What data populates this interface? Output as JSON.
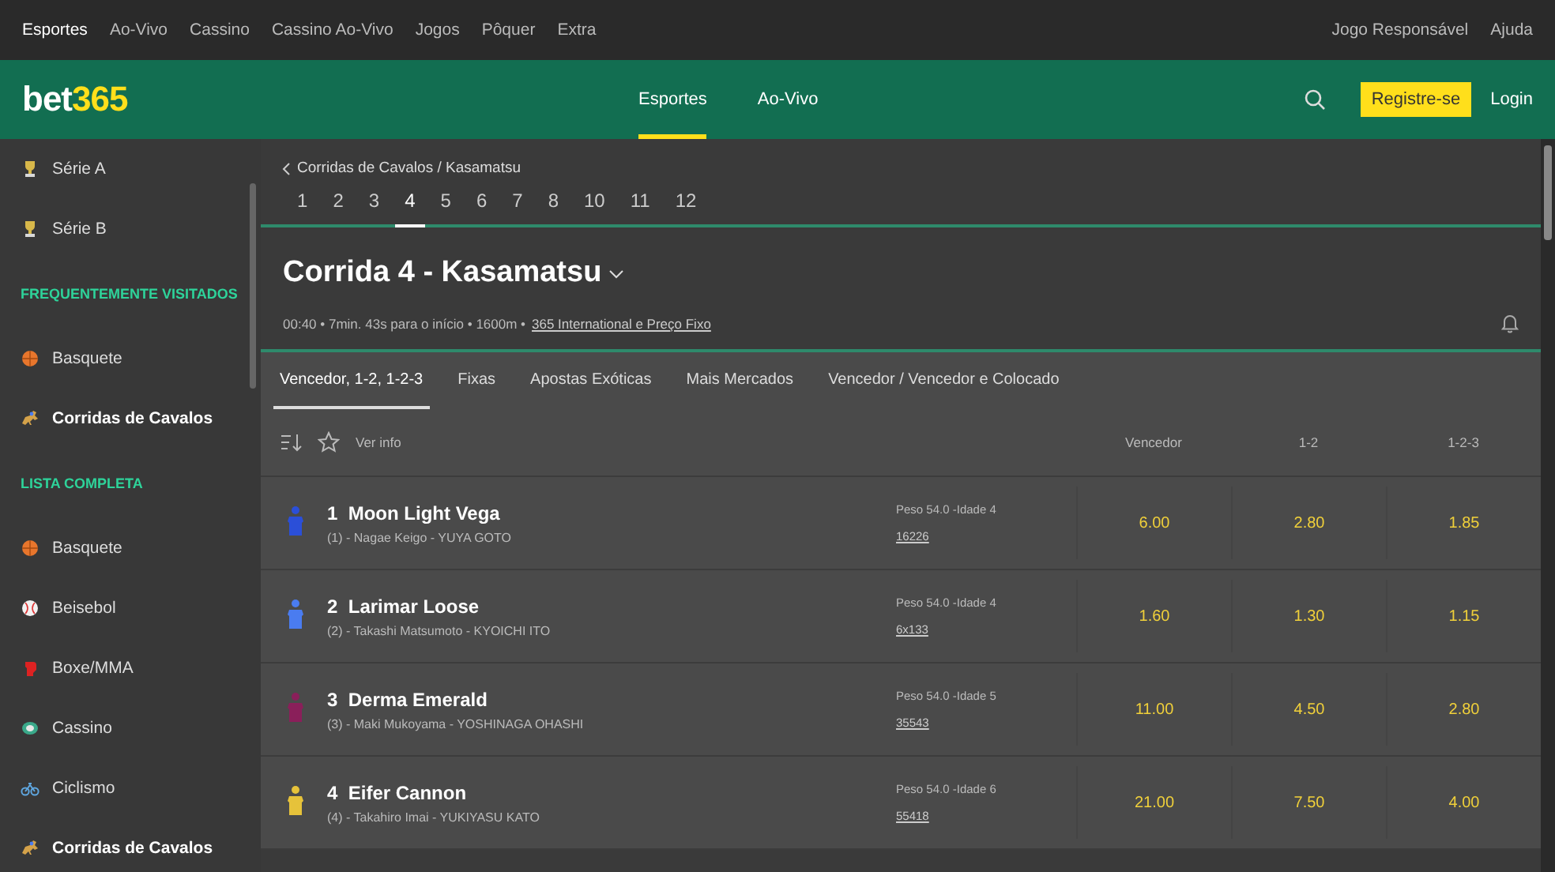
{
  "top_nav": {
    "items": [
      {
        "label": "Esportes",
        "selected": true
      },
      {
        "label": "Ao-Vivo",
        "selected": false
      },
      {
        "label": "Cassino",
        "selected": false
      },
      {
        "label": "Cassino Ao-Vivo",
        "selected": false
      },
      {
        "label": "Jogos",
        "selected": false
      },
      {
        "label": "Pôquer",
        "selected": false
      },
      {
        "label": "Extra",
        "selected": false
      }
    ],
    "right_links": [
      "Jogo Responsável",
      "Ajuda"
    ]
  },
  "header": {
    "logo": {
      "prefix": "bet",
      "suffix": "365"
    },
    "tabs": [
      {
        "label": "Esportes",
        "selected": true
      },
      {
        "label": "Ao-Vivo",
        "selected": false
      }
    ],
    "register_button": "Registre-se",
    "login": "Login"
  },
  "sidebar": {
    "items": [
      {
        "kind": "item",
        "label": "Série A",
        "selected": false
      },
      {
        "kind": "item",
        "label": "Série B",
        "selected": false
      },
      {
        "kind": "heading",
        "label": "FREQUENTEMENTE VISITADOS"
      },
      {
        "kind": "item",
        "label": "Basquete",
        "selected": false
      },
      {
        "kind": "item",
        "label": "Corridas de Cavalos",
        "selected": true
      },
      {
        "kind": "heading",
        "label": "LISTA COMPLETA"
      },
      {
        "kind": "item",
        "label": "Basquete",
        "selected": false
      },
      {
        "kind": "item",
        "label": "Beisebol",
        "selected": false
      },
      {
        "kind": "item",
        "label": "Boxe/MMA",
        "selected": false
      },
      {
        "kind": "item",
        "label": "Cassino",
        "selected": false
      },
      {
        "kind": "item",
        "label": "Ciclismo",
        "selected": false
      },
      {
        "kind": "item",
        "label": "Corridas de Cavalos",
        "selected": true
      }
    ]
  },
  "breadcrumb": "Corridas de Cavalos / Kasamatsu",
  "race_tabs": [
    {
      "label": "1",
      "selected": false
    },
    {
      "label": "2",
      "selected": false
    },
    {
      "label": "3",
      "selected": false
    },
    {
      "label": "4",
      "selected": true
    },
    {
      "label": "5",
      "selected": false
    },
    {
      "label": "6",
      "selected": false
    },
    {
      "label": "7",
      "selected": false
    },
    {
      "label": "8",
      "selected": false
    },
    {
      "label": "10",
      "selected": false
    },
    {
      "label": "11",
      "selected": false
    },
    {
      "label": "12",
      "selected": false
    }
  ],
  "race": {
    "title": "Corrida 4 - Kasamatsu",
    "meta": "00:40 • 7min. 43s para o início • 1600m •",
    "link": "365 International e Preço Fixo"
  },
  "market_tabs": [
    {
      "label": "Vencedor, 1-2, 1-2-3",
      "selected": true
    },
    {
      "label": "Fixas",
      "selected": false
    },
    {
      "label": "Apostas Exóticas",
      "selected": false
    },
    {
      "label": "Mais Mercados",
      "selected": false
    },
    {
      "label": "Vencedor / Vencedor e Colocado",
      "selected": false
    }
  ],
  "table": {
    "info_link": "Ver info",
    "columns": [
      "Vencedor",
      "1-2",
      "1-2-3"
    ],
    "rows": [
      {
        "number": "1",
        "name": "Moon Light Vega",
        "details": "(1) - Nagae Keigo - YUYA GOTO",
        "weight_age": "Peso 54.0 -Idade 4",
        "form": "16226",
        "color": "#2b4fd8",
        "odds": [
          "6.00",
          "2.80",
          "1.85"
        ]
      },
      {
        "number": "2",
        "name": "Larimar Loose",
        "details": "(2) - Takashi Matsumoto - KYOICHI ITO",
        "weight_age": "Peso 54.0 -Idade 4",
        "form": "6x133",
        "color": "#4a7cf0",
        "odds": [
          "1.60",
          "1.30",
          "1.15"
        ]
      },
      {
        "number": "3",
        "name": "Derma Emerald",
        "details": "(3) - Maki Mukoyama - YOSHINAGA OHASHI",
        "weight_age": "Peso 54.0 -Idade 5",
        "form": "35543",
        "color": "#8a1f5a",
        "odds": [
          "11.00",
          "4.50",
          "2.80"
        ]
      },
      {
        "number": "4",
        "name": "Eifer Cannon",
        "details": "(4) - Takahiro Imai - YUKIYASU KATO",
        "weight_age": "Peso 54.0 -Idade 6",
        "form": "55418",
        "color": "#e6c23a",
        "odds": [
          "21.00",
          "7.50",
          "4.00"
        ]
      }
    ]
  }
}
